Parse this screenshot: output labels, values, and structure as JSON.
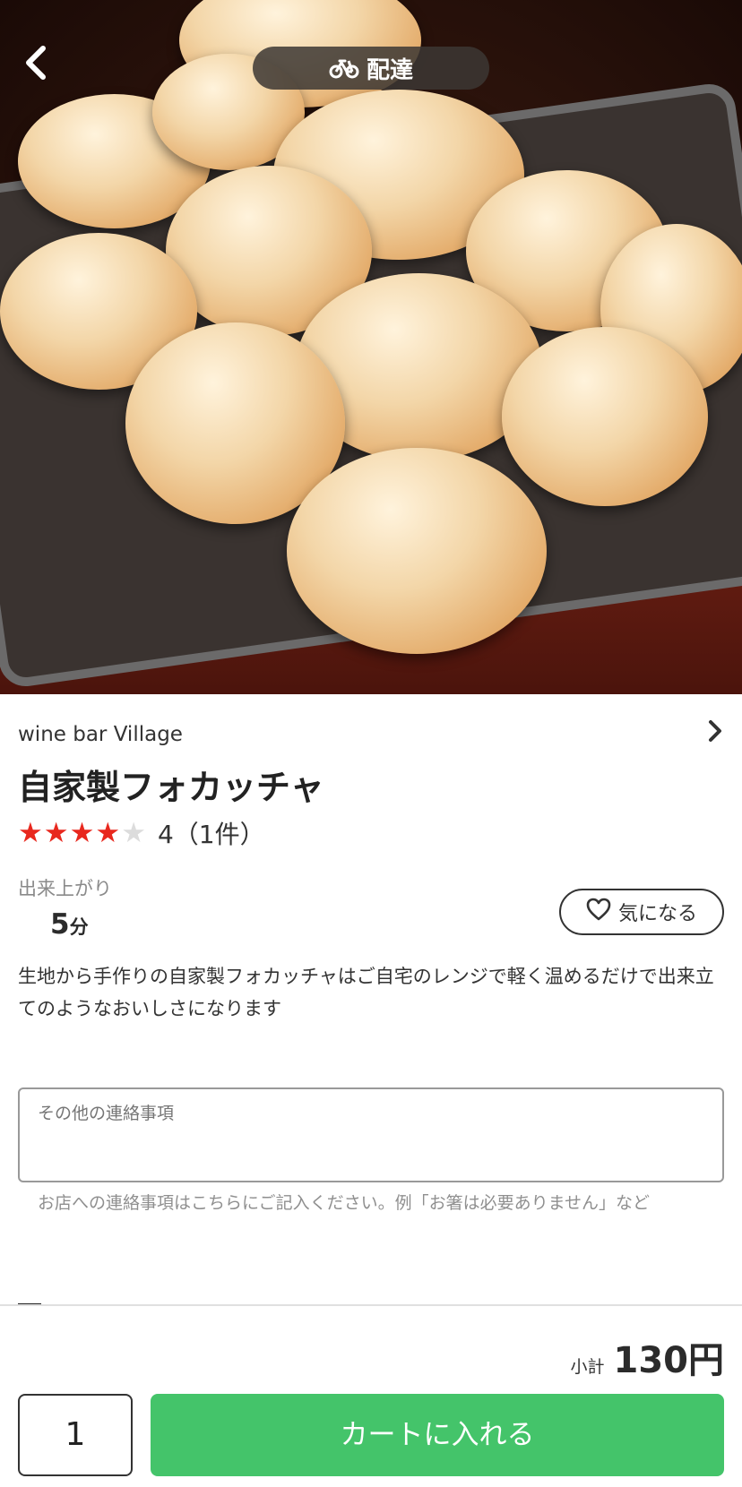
{
  "header": {
    "back_icon": "chevron-left-icon",
    "delivery_label": "配達",
    "delivery_icon": "bicycle-icon"
  },
  "shop": {
    "name": "wine bar Village"
  },
  "product": {
    "title": "自家製フォカッチャ",
    "rating_value": 4,
    "rating_max": 5,
    "rating_text": "4（1件）",
    "ready_label": "出来上がり",
    "ready_number": "5",
    "ready_unit": "分",
    "favorite_label": "気になる",
    "description": "生地から手作りの自家製フォカッチャはご自宅のレンジで軽く温めるだけで出来立てのようなおいしさになります"
  },
  "note": {
    "placeholder": "その他の連絡事項",
    "help_text": "お店への連絡事項はこちらにご記入ください。例「お箸は必要ありません」など"
  },
  "footer": {
    "subtotal_label": "小計",
    "subtotal_value": "130円",
    "quantity": "1",
    "add_to_cart_label": "カートに入れる"
  },
  "colors": {
    "accent_green": "#44c46a",
    "star_red": "#e8281e"
  }
}
